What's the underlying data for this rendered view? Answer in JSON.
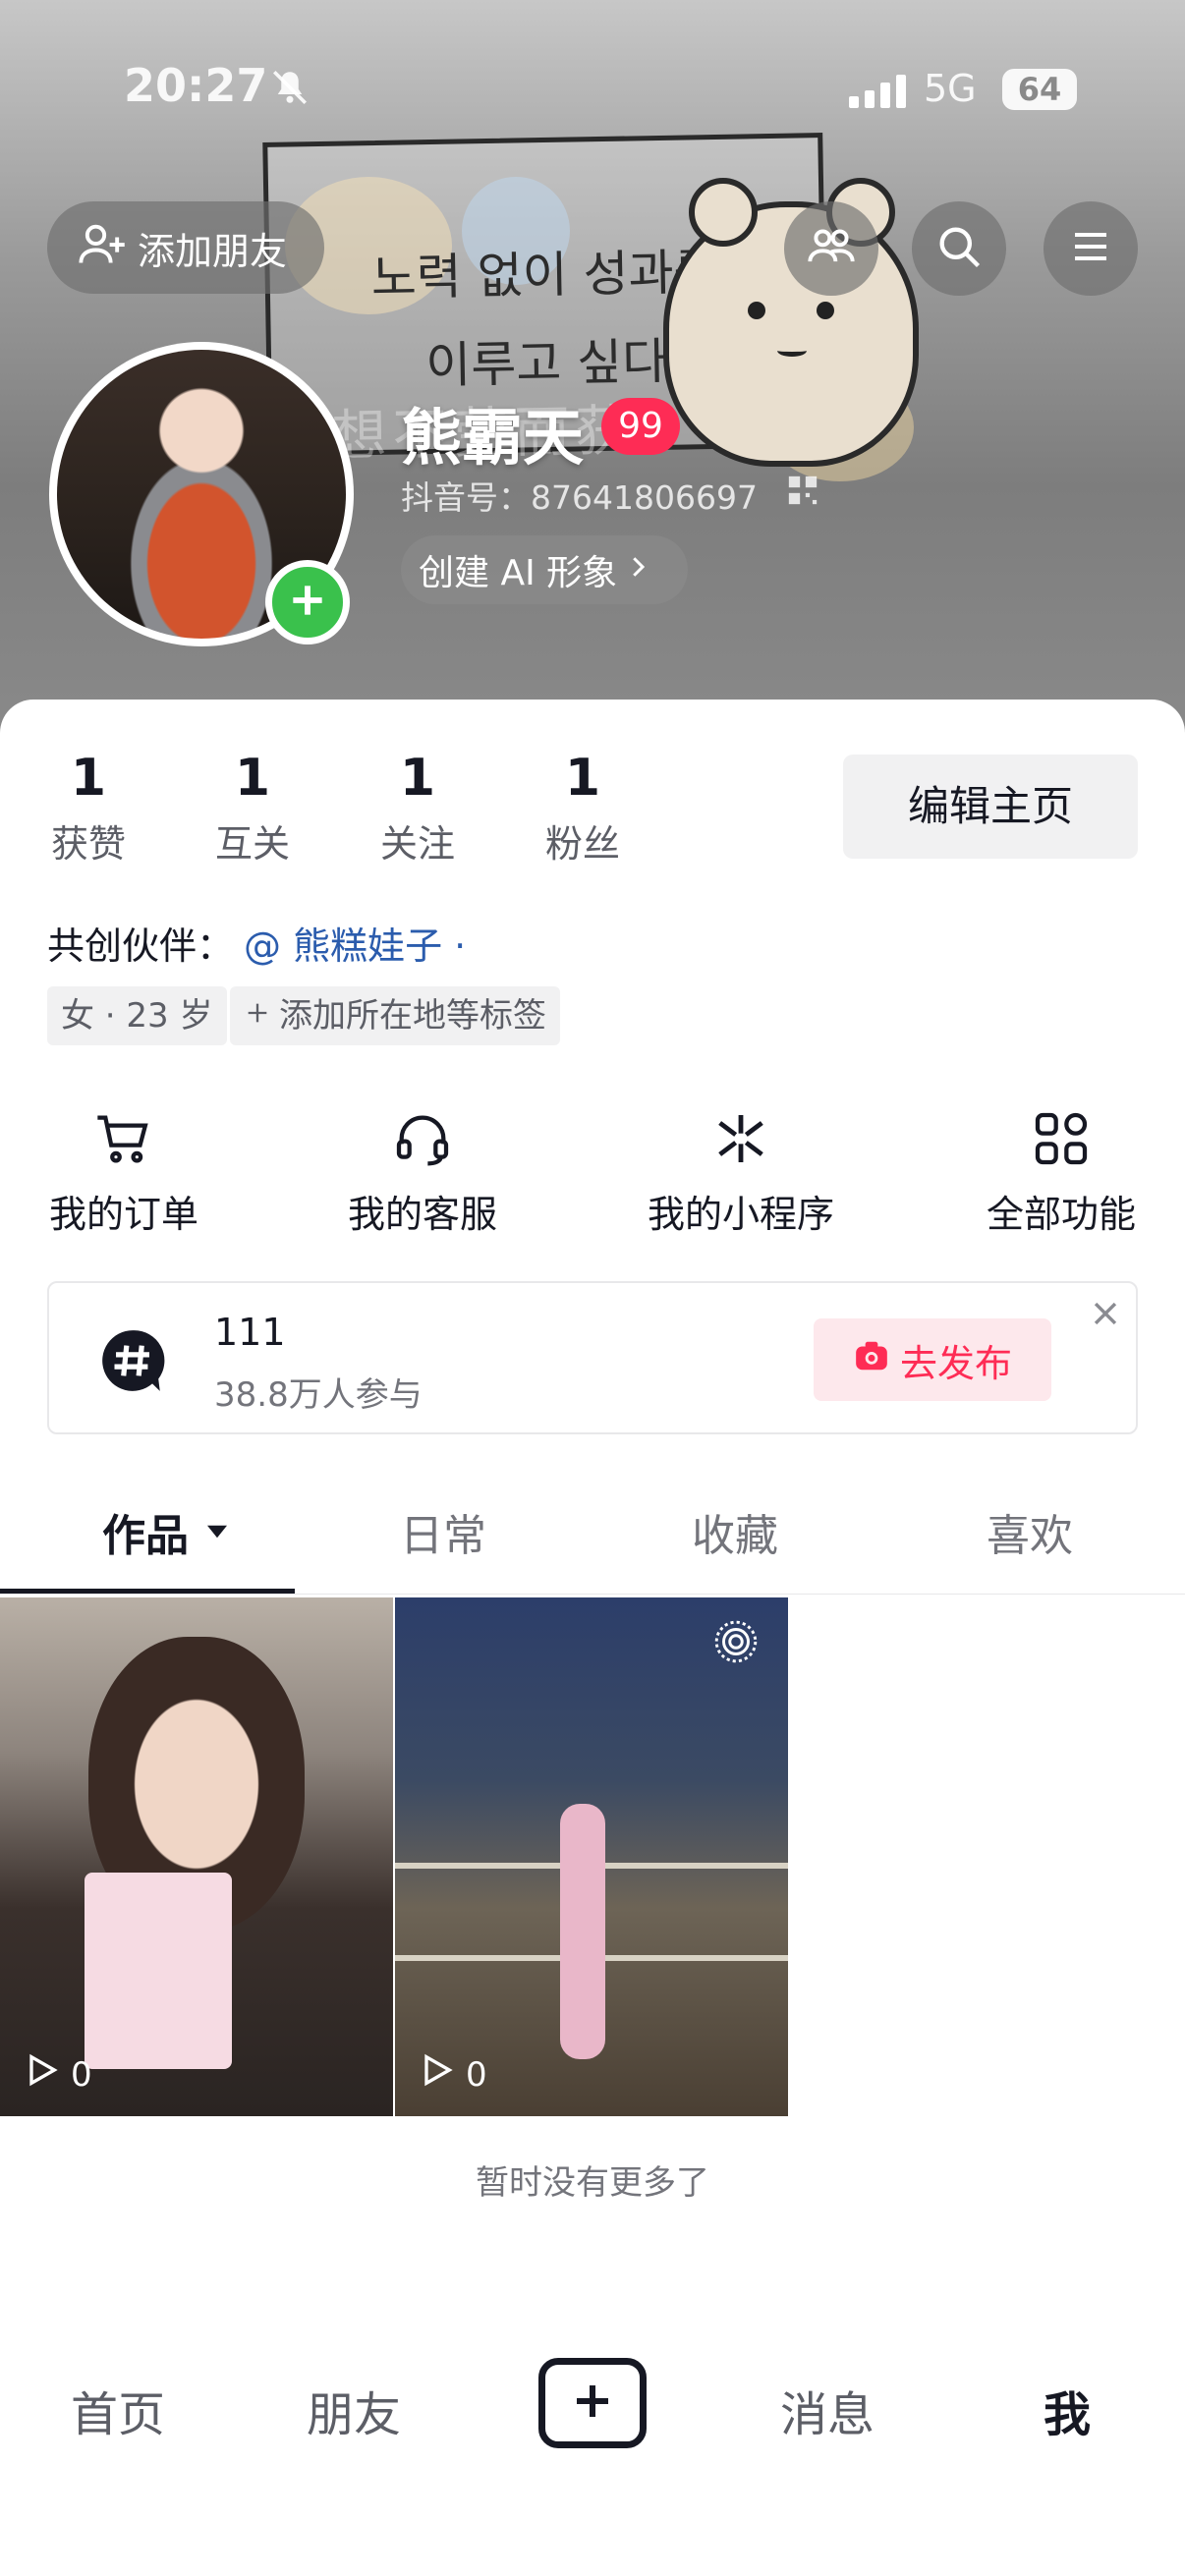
{
  "status_bar": {
    "time": "20:27",
    "network": "5G",
    "battery": "64"
  },
  "header": {
    "add_friend_label": "添加朋友",
    "sign_line1": "노력 없이 성과를",
    "sign_line2": "이루고 싶다",
    "sign_ghost": "想不劳而获",
    "username": "熊霸天",
    "badge_count": "99",
    "douyin_id": "抖音号：87641806697",
    "ai_avatar_label": "创建 AI 形象"
  },
  "stats": [
    {
      "value": "1",
      "label": "获赞"
    },
    {
      "value": "1",
      "label": "互关"
    },
    {
      "value": "1",
      "label": "关注"
    },
    {
      "value": "1",
      "label": "粉丝"
    }
  ],
  "edit_profile_label": "编辑主页",
  "partner": {
    "label": "共创伙伴：",
    "name": "@ 熊糕娃子 ·"
  },
  "tags": {
    "gender_age": "女 · 23 岁",
    "add_tag": "添加所在地等标签"
  },
  "functions": [
    {
      "label": "我的订单",
      "icon": "cart-icon"
    },
    {
      "label": "我的客服",
      "icon": "headset-icon"
    },
    {
      "label": "我的小程序",
      "icon": "mini-program-icon"
    },
    {
      "label": "全部功能",
      "icon": "grid-icon"
    }
  ],
  "topic_banner": {
    "title": "111",
    "subtitle": "38.8万人参与",
    "button": "去发布"
  },
  "tabs": [
    {
      "label": "作品",
      "active": true
    },
    {
      "label": "日常",
      "active": false
    },
    {
      "label": "收藏",
      "active": false
    },
    {
      "label": "喜欢",
      "active": false
    }
  ],
  "videos": [
    {
      "plays": "0"
    },
    {
      "plays": "0"
    }
  ],
  "end_message": "暂时没有更多了",
  "nav": {
    "home": "首页",
    "friends": "朋友",
    "messages": "消息",
    "me": "我"
  },
  "colors": {
    "accent": "#fe2c55",
    "green": "#3ac14c",
    "link": "#2b5cad"
  }
}
